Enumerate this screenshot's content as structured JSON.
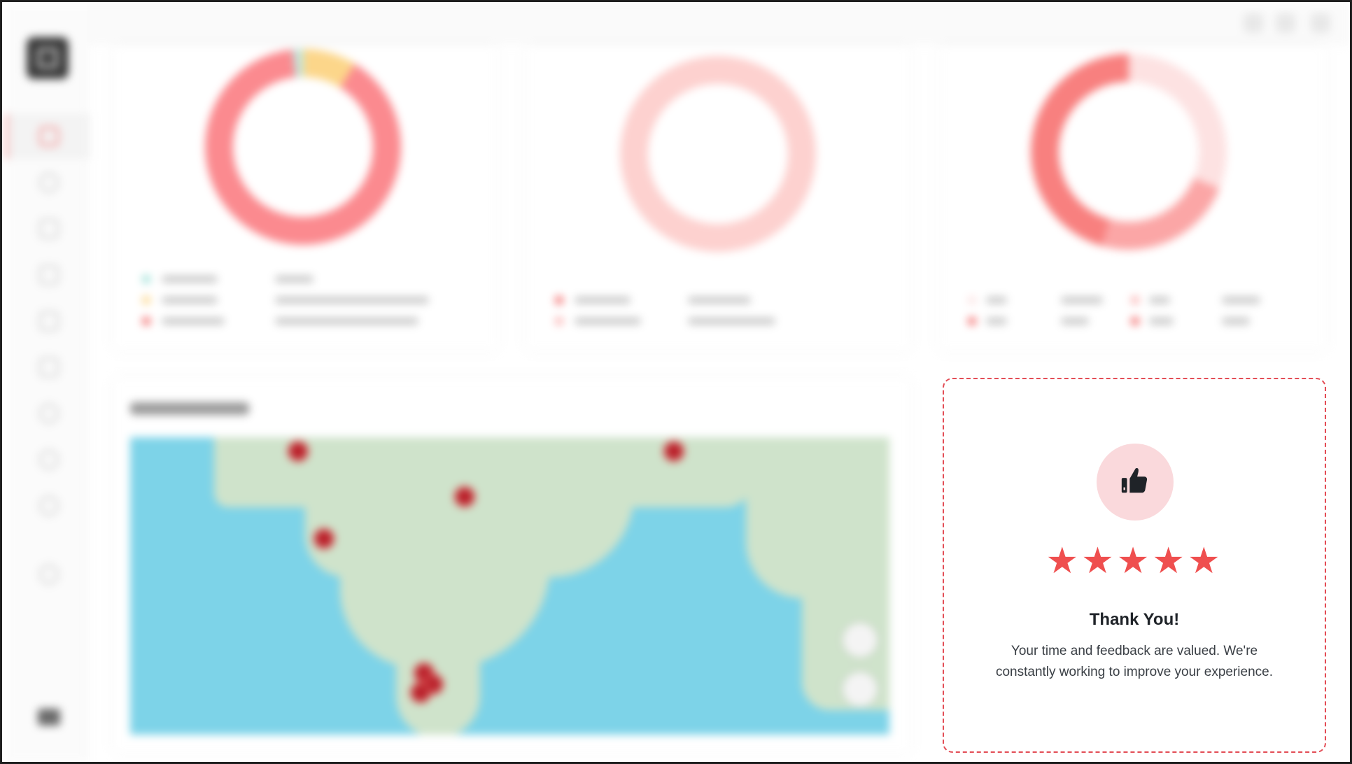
{
  "feedback": {
    "title": "Thank You!",
    "message": "Your time and feedback are valued. We're constantly working to improve your experience.",
    "rating": 5,
    "rating_max": 5,
    "star_glyph": "★",
    "icon": "thumbs-up-icon"
  },
  "colors": {
    "accent": "#e34d56",
    "star": "#ef4f4f",
    "donut_primary": "#fb8a8f",
    "donut_light": "#fdd1cf",
    "donut_yellow": "#fcd68a",
    "map_water": "#7dd3e8"
  }
}
